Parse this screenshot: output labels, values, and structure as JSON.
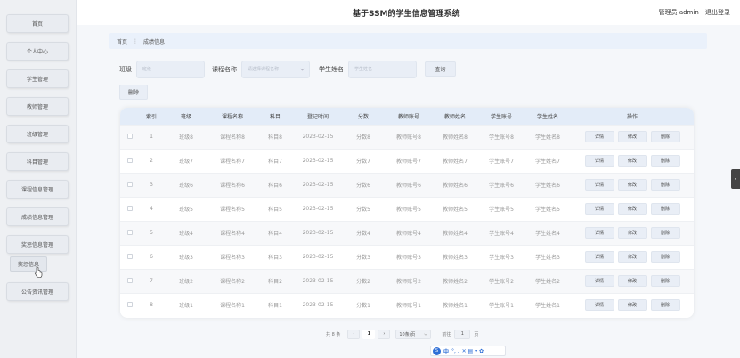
{
  "header": {
    "title": "基于SSM的学生信息管理系统",
    "user": "管理员 admin",
    "logout": "退出登录"
  },
  "sidebar": {
    "items": [
      {
        "label": "首页"
      },
      {
        "label": "个人中心"
      },
      {
        "label": "学生管理"
      },
      {
        "label": "教师管理"
      },
      {
        "label": "班级管理"
      },
      {
        "label": "科目管理"
      },
      {
        "label": "课程信息管理"
      },
      {
        "label": "成绩信息管理"
      },
      {
        "label": "奖惩信息管理"
      },
      {
        "label": "公告资讯管理"
      }
    ],
    "sub_item": "奖惩信息"
  },
  "breadcrumb": {
    "home": "首页",
    "separator": "⋮",
    "current": "成绩信息"
  },
  "search": {
    "class_label": "班级",
    "class_placeholder": "班级",
    "course_label": "课程名称",
    "course_placeholder": "请选择课程名称",
    "name_label": "学生姓名",
    "name_placeholder": "学生姓名",
    "query_button": "查询"
  },
  "actions": {
    "delete_button": "删除"
  },
  "table": {
    "headers": [
      "",
      "索引",
      "班级",
      "课程名称",
      "科目",
      "登记时间",
      "分数",
      "教师账号",
      "教师姓名",
      "学生账号",
      "学生姓名",
      "操作"
    ],
    "rows": [
      {
        "index": "1",
        "class": "班级8",
        "course": "课程名称8",
        "subject": "科目8",
        "date": "2023-02-15",
        "score": "分数8",
        "teacher_acct": "教师账号8",
        "teacher_name": "教师姓名8",
        "student_acct": "学生账号8",
        "student_name": "学生姓名8"
      },
      {
        "index": "2",
        "class": "班级7",
        "course": "课程名称7",
        "subject": "科目7",
        "date": "2023-02-15",
        "score": "分数7",
        "teacher_acct": "教师账号7",
        "teacher_name": "教师姓名7",
        "student_acct": "学生账号7",
        "student_name": "学生姓名7"
      },
      {
        "index": "3",
        "class": "班级6",
        "course": "课程名称6",
        "subject": "科目6",
        "date": "2023-02-15",
        "score": "分数6",
        "teacher_acct": "教师账号6",
        "teacher_name": "教师姓名6",
        "student_acct": "学生账号6",
        "student_name": "学生姓名6"
      },
      {
        "index": "4",
        "class": "班级5",
        "course": "课程名称5",
        "subject": "科目5",
        "date": "2023-02-15",
        "score": "分数5",
        "teacher_acct": "教师账号5",
        "teacher_name": "教师姓名5",
        "student_acct": "学生账号5",
        "student_name": "学生姓名5"
      },
      {
        "index": "5",
        "class": "班级4",
        "course": "课程名称4",
        "subject": "科目4",
        "date": "2023-02-15",
        "score": "分数4",
        "teacher_acct": "教师账号4",
        "teacher_name": "教师姓名4",
        "student_acct": "学生账号4",
        "student_name": "学生姓名4"
      },
      {
        "index": "6",
        "class": "班级3",
        "course": "课程名称3",
        "subject": "科目3",
        "date": "2023-02-15",
        "score": "分数3",
        "teacher_acct": "教师账号3",
        "teacher_name": "教师姓名3",
        "student_acct": "学生账号3",
        "student_name": "学生姓名3"
      },
      {
        "index": "7",
        "class": "班级2",
        "course": "课程名称2",
        "subject": "科目2",
        "date": "2023-02-15",
        "score": "分数2",
        "teacher_acct": "教师账号2",
        "teacher_name": "教师姓名2",
        "student_acct": "学生账号2",
        "student_name": "学生姓名2"
      },
      {
        "index": "8",
        "class": "班级1",
        "course": "课程名称1",
        "subject": "科目1",
        "date": "2023-02-15",
        "score": "分数1",
        "teacher_acct": "教师账号1",
        "teacher_name": "教师姓名1",
        "student_acct": "学生账号1",
        "student_name": "学生姓名1"
      }
    ],
    "row_actions": {
      "detail": "详情",
      "edit": "修改",
      "delete": "删除"
    }
  },
  "pagination": {
    "total": "共 8 条",
    "prev": "‹",
    "current_page": "1",
    "next": "›",
    "page_size": "10条/页",
    "goto_label": "前往",
    "goto_value": "1",
    "page_unit": "页"
  },
  "ime": {
    "logo": "S",
    "lang": "中",
    "icons": "°, ♩ ✕ ▤ ▾ ✿"
  },
  "handle": "‹",
  "icons": {
    "cursor": "hand-cursor-icon"
  }
}
